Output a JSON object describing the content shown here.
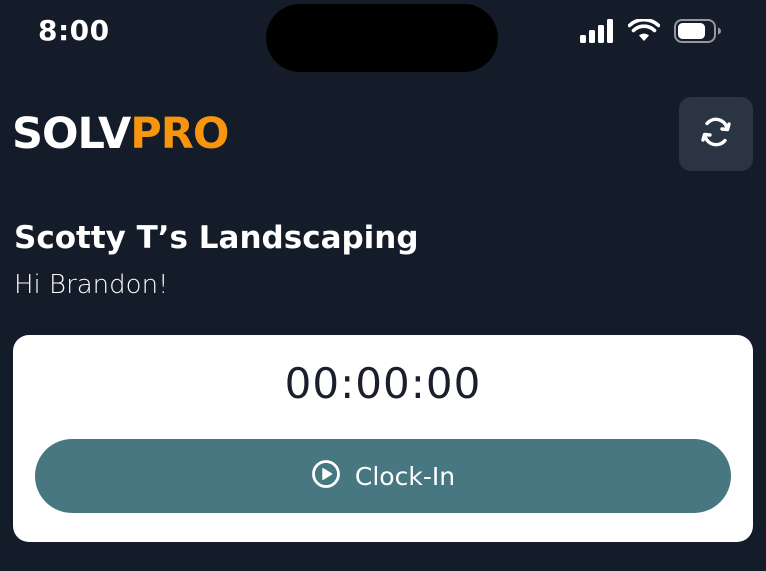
{
  "status_bar": {
    "time": "8:00",
    "icons": [
      "cellular-signal-icon",
      "wifi-icon",
      "battery-icon"
    ]
  },
  "header": {
    "brand_part1": "SOLV",
    "brand_part2": "PRO",
    "sync_icon": "refresh-sync-icon"
  },
  "greeting": {
    "company": "Scotty T’s Landscaping",
    "message": "Hi Brandon!"
  },
  "timer": {
    "elapsed": "00:00:00",
    "button_label": "Clock-In",
    "button_icon": "play-circle-icon"
  },
  "colors": {
    "background": "#141b29",
    "brand_accent": "#f7950f",
    "button": "#477781",
    "card": "#ffffff",
    "sync_button_bg": "#2b3442"
  }
}
